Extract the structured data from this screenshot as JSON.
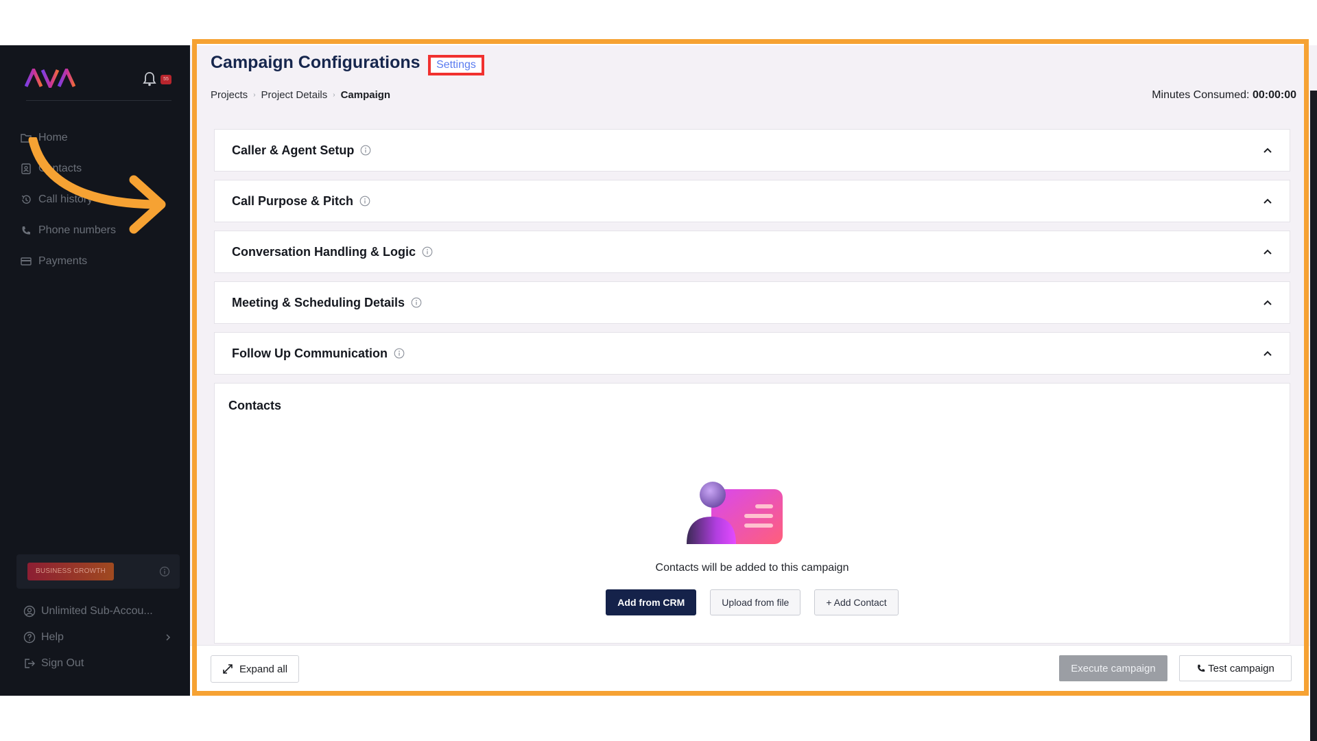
{
  "sidebar": {
    "logo_text": "AVA",
    "notification_count": "55",
    "nav": [
      {
        "label": "Home",
        "icon": "folder-icon"
      },
      {
        "label": "Contacts",
        "icon": "contact-card-icon"
      },
      {
        "label": "Call history",
        "icon": "history-icon"
      },
      {
        "label": "Phone numbers",
        "icon": "phone-icon"
      },
      {
        "label": "Payments",
        "icon": "card-icon"
      }
    ],
    "plan_badge": "BUSINESS GROWTH",
    "bottom": [
      {
        "label": "Unlimited Sub-Accou...",
        "icon": "user-circle-icon"
      },
      {
        "label": "Help",
        "icon": "help-icon"
      },
      {
        "label": "Sign Out",
        "icon": "sign-out-icon"
      }
    ]
  },
  "header": {
    "title": "Campaign Configurations",
    "settings_label": "Settings",
    "breadcrumbs": [
      "Projects",
      "Project Details",
      "Campaign"
    ],
    "minutes_label": "Minutes Consumed:",
    "minutes_value": "00:00:00"
  },
  "sections": [
    {
      "label": "Caller & Agent Setup"
    },
    {
      "label": "Call Purpose & Pitch"
    },
    {
      "label": "Conversation Handling & Logic"
    },
    {
      "label": "Meeting & Scheduling Details"
    },
    {
      "label": "Follow Up Communication"
    }
  ],
  "contacts": {
    "title": "Contacts",
    "empty_message": "Contacts will be added to this campaign",
    "add_from_crm": "Add from CRM",
    "upload_from_file": "Upload from file",
    "add_contact": "+ Add Contact"
  },
  "footer": {
    "expand_all": "Expand all",
    "execute_campaign": "Execute campaign",
    "test_campaign": "Test campaign"
  },
  "colors": {
    "sidebar_bg": "#12151c",
    "primary": "#15224a",
    "highlight_frame": "#f6a233",
    "settings_highlight": "#f1312f",
    "settings_link": "#5a7cf0"
  }
}
